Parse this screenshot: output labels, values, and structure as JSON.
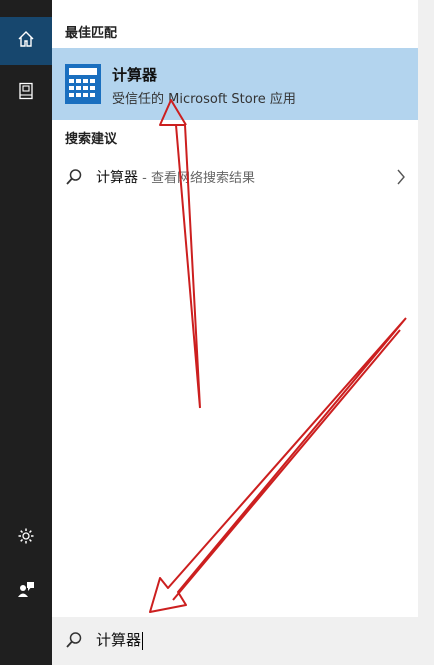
{
  "sidebar": {
    "items": [
      {
        "icon": "home-icon"
      },
      {
        "icon": "document-icon"
      },
      {
        "icon": "gear-icon"
      },
      {
        "icon": "account-feedback-icon"
      }
    ]
  },
  "best_match": {
    "heading": "最佳匹配",
    "app_name": "计算器",
    "app_subtitle": "受信任的 Microsoft Store 应用",
    "icon": "calculator-icon"
  },
  "suggestions": {
    "heading": "搜索建议",
    "items": [
      {
        "term": "计算器",
        "hint": " - 查看网络搜索结果"
      }
    ]
  },
  "search": {
    "value": "计算器",
    "icon": "search-icon"
  },
  "colors": {
    "sidebar_bg": "#1f1f1f",
    "sidebar_active": "#17476e",
    "selection_bg": "#b3d4ee",
    "annotation_red": "#cc1f1f"
  }
}
